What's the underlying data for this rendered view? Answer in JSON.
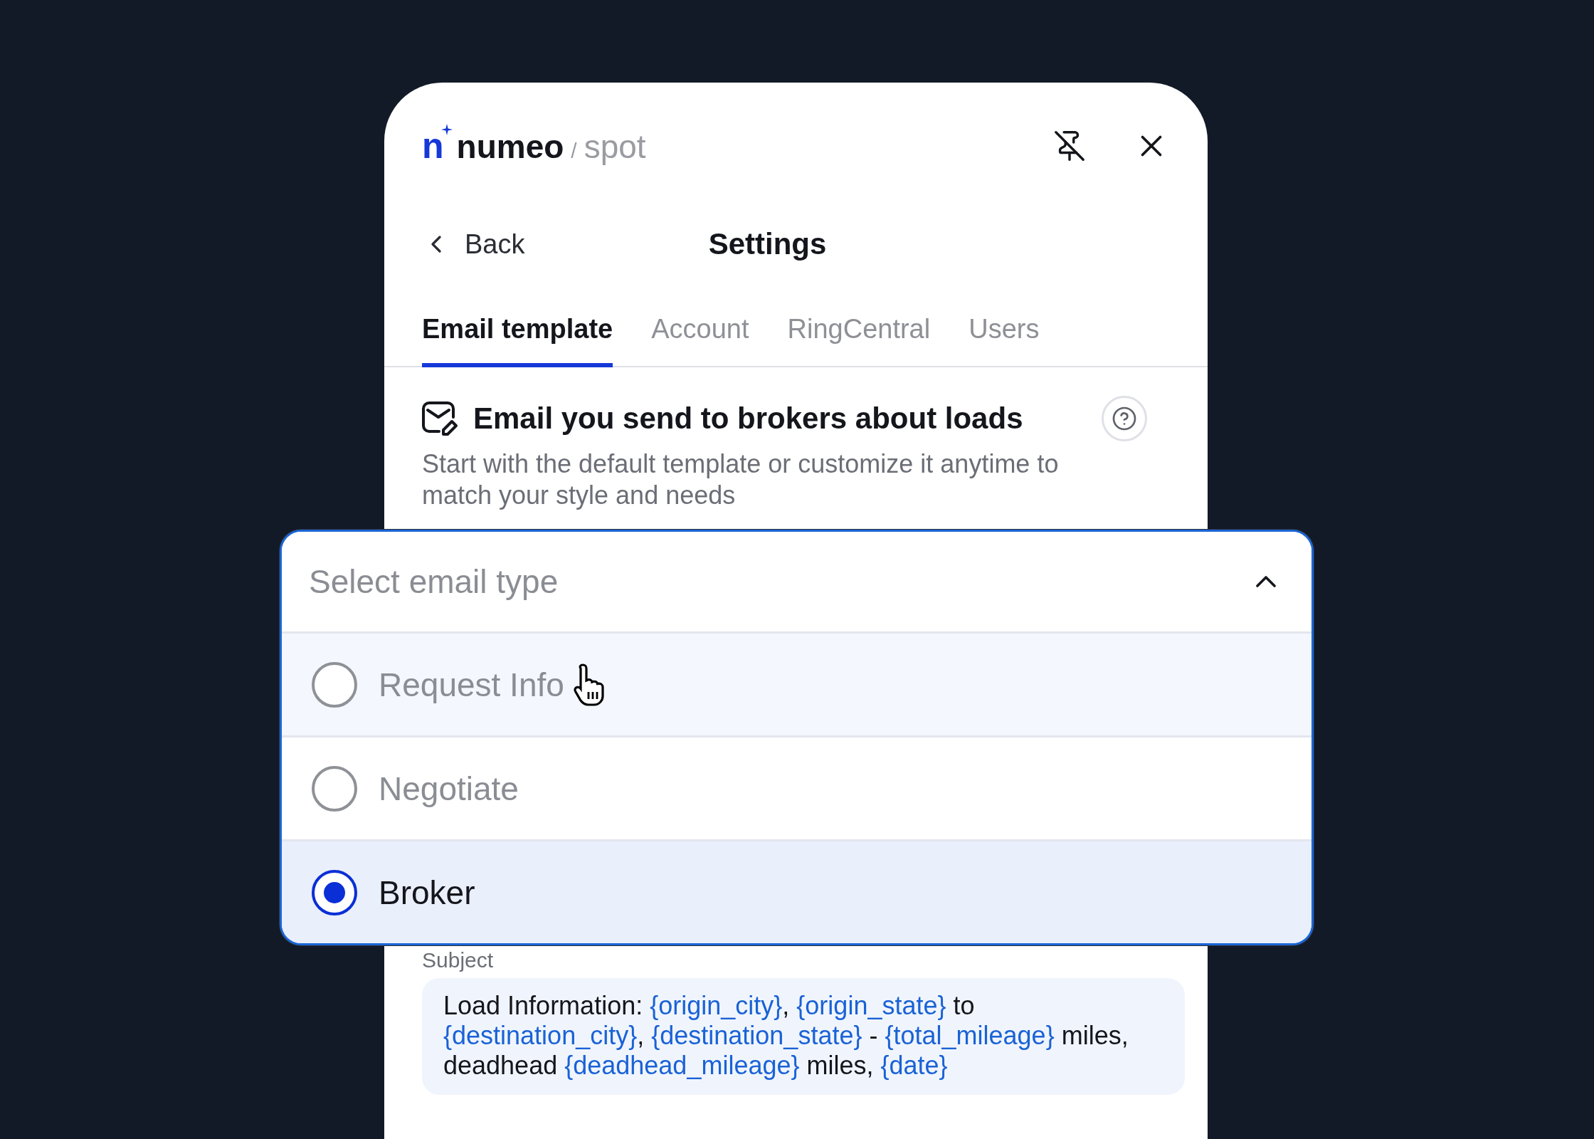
{
  "header": {
    "logo": {
      "mark": "n",
      "name": "numeo",
      "separator": "/",
      "product": "spot"
    }
  },
  "nav": {
    "back": "Back",
    "title": "Settings"
  },
  "tabs": [
    {
      "label": "Email template",
      "selected": true
    },
    {
      "label": "Account",
      "selected": false
    },
    {
      "label": "RingCentral",
      "selected": false
    },
    {
      "label": "Users",
      "selected": false
    }
  ],
  "section": {
    "title": "Email you send to brokers about loads",
    "description": "Start with the default template or customize it anytime to match your style and needs"
  },
  "email_type_select": {
    "placeholder": "Select email type",
    "expanded": true,
    "options": [
      {
        "label": "Request Info",
        "selected": false,
        "hovered": true
      },
      {
        "label": "Negotiate",
        "selected": false,
        "hovered": false
      },
      {
        "label": "Broker",
        "selected": true,
        "hovered": false
      }
    ]
  },
  "subject": {
    "label": "Subject",
    "parts": [
      {
        "kind": "plain",
        "text": "Load Information: "
      },
      {
        "kind": "variable",
        "text": "{origin_city}"
      },
      {
        "kind": "plain",
        "text": ", "
      },
      {
        "kind": "variable",
        "text": "{origin_state}"
      },
      {
        "kind": "plain",
        "text": " to "
      },
      {
        "kind": "variable",
        "text": "{destination_city}"
      },
      {
        "kind": "plain",
        "text": ", "
      },
      {
        "kind": "variable",
        "text": "{destination_state}"
      },
      {
        "kind": "plain",
        "text": " - "
      },
      {
        "kind": "variable",
        "text": "{total_mileage}"
      },
      {
        "kind": "plain",
        "text": " miles, deadhead "
      },
      {
        "kind": "variable",
        "text": "{deadhead_mileage}"
      },
      {
        "kind": "plain",
        "text": " miles, "
      },
      {
        "kind": "variable",
        "text": "{date}"
      }
    ]
  }
}
